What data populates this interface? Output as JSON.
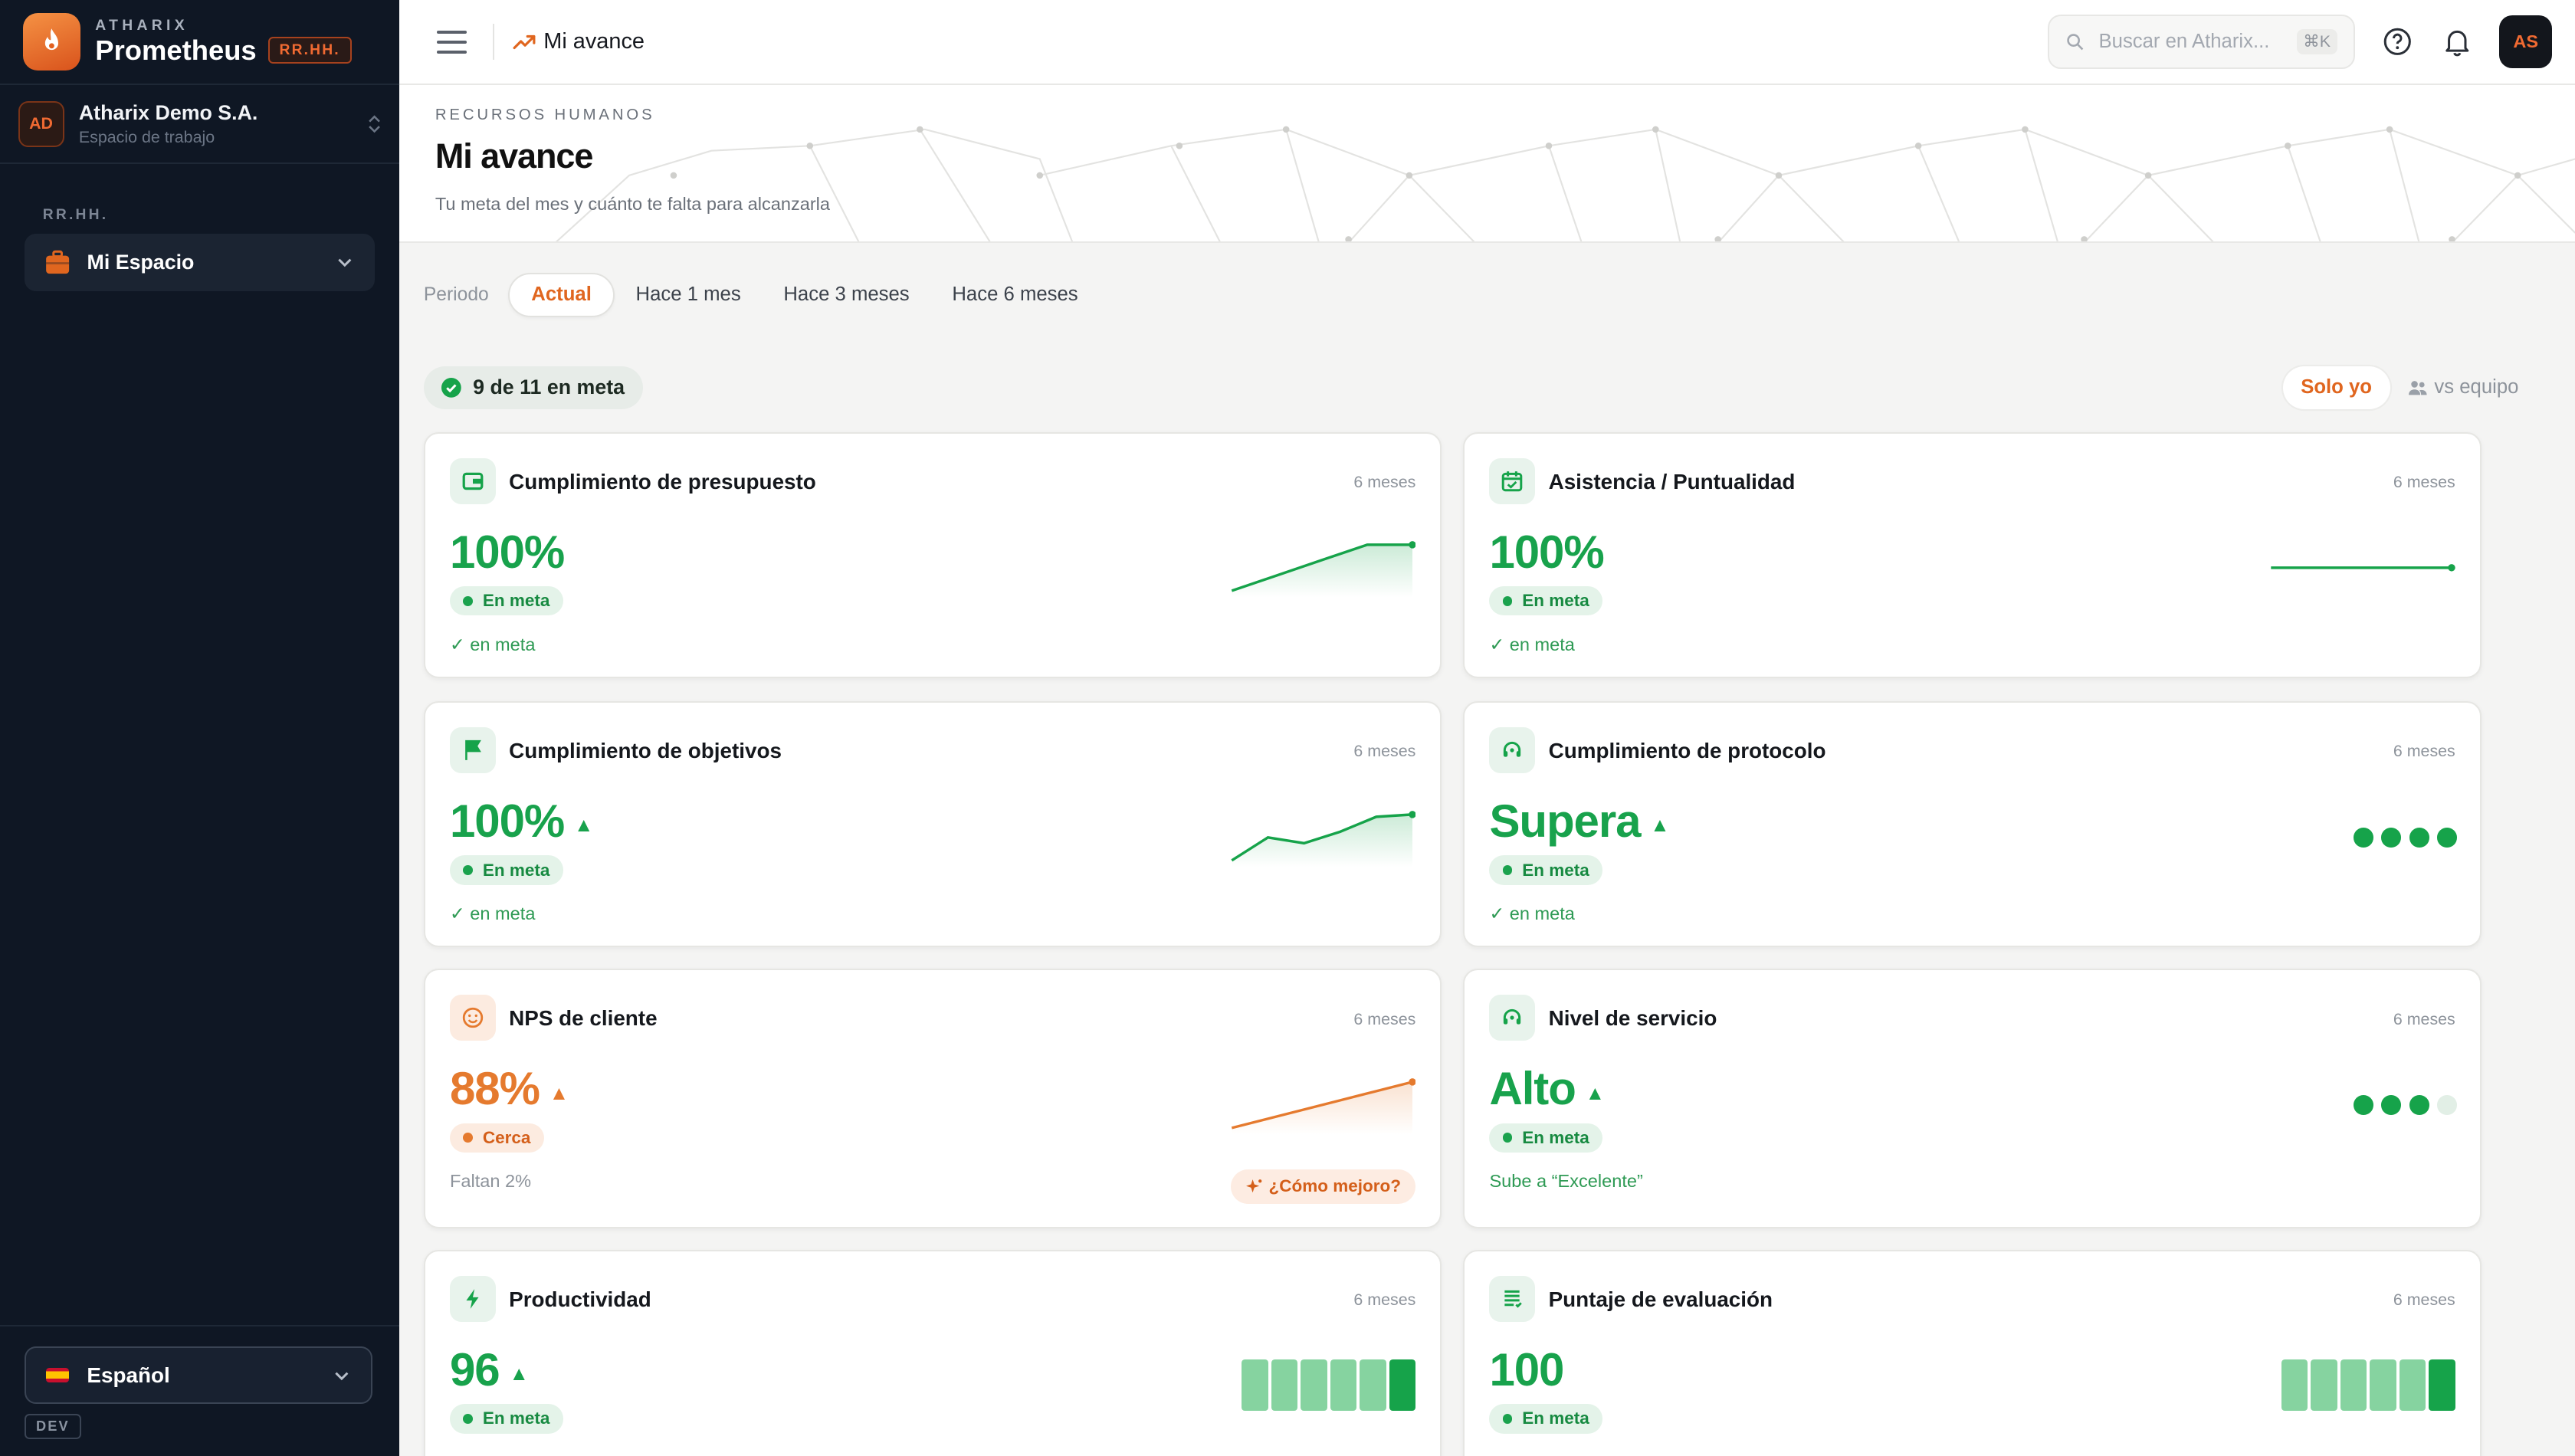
{
  "brand": {
    "company": "ATHARIX",
    "app": "Prometheus",
    "tag": "RR.HH."
  },
  "workspace": {
    "initials": "AD",
    "name": "Atharix Demo S.A.",
    "sub": "Espacio de trabajo"
  },
  "sidebar": {
    "section": "RR.HH.",
    "items": [
      {
        "label": "Mi Espacio",
        "icon": "briefcase-icon"
      }
    ]
  },
  "language": {
    "label": "Español",
    "env": "DEV"
  },
  "topbar": {
    "breadcrumb": "Mi avance",
    "search_placeholder": "Buscar en Atharix...",
    "search_shortcut": "⌘K",
    "user_initials": "AS"
  },
  "header": {
    "eyebrow": "RECURSOS HUMANOS",
    "title": "Mi avance",
    "subtitle": "Tu meta del mes y cuánto te falta para alcanzarla"
  },
  "period": {
    "label": "Periodo",
    "tabs": [
      "Actual",
      "Hace 1 mes",
      "Hace 3 meses",
      "Hace 6 meses"
    ],
    "active": "Actual"
  },
  "summary": {
    "text": "9 de 11 en meta"
  },
  "view_toggle": {
    "options": [
      "Solo yo",
      "vs equipo"
    ],
    "active": "Solo yo"
  },
  "colors": {
    "accent": "#e0661f",
    "success": "#18a24c",
    "warning": "#e57a2e",
    "sidebar_bg": "#0f1724"
  },
  "cards": [
    {
      "title": "Cumplimiento de presupuesto",
      "icon": "wallet-icon",
      "period": "6 meses",
      "value": "100%",
      "trend": "",
      "badge": "En meta",
      "status": "ok",
      "foot": "✓ en meta",
      "viz": "line",
      "series": [
        70,
        80,
        90,
        100,
        100
      ]
    },
    {
      "title": "Asistencia / Puntualidad",
      "icon": "calendar-check-icon",
      "period": "6 meses",
      "value": "100%",
      "trend": "",
      "badge": "En meta",
      "status": "ok",
      "foot": "✓ en meta",
      "viz": "line",
      "series": [
        100,
        100,
        100,
        100,
        100
      ]
    },
    {
      "title": "Cumplimiento de objetivos",
      "icon": "flag-icon",
      "period": "6 meses",
      "value": "100%",
      "trend": "▲",
      "badge": "En meta",
      "status": "ok",
      "foot": "✓ en meta",
      "viz": "line",
      "series": [
        60,
        80,
        75,
        85,
        98,
        100
      ]
    },
    {
      "title": "Cumplimiento de protocolo",
      "icon": "headset-icon",
      "period": "6 meses",
      "value": "Supera",
      "trend": "▲",
      "badge": "En meta",
      "status": "ok",
      "foot": "✓ en meta",
      "viz": "dots",
      "level": 4,
      "level_max": 4
    },
    {
      "title": "NPS de cliente",
      "icon": "smile-icon",
      "period": "6 meses",
      "value": "88%",
      "trend": "▲",
      "badge": "Cerca",
      "status": "near",
      "foot": "Faltan 2%",
      "viz": "line",
      "series": [
        78,
        80,
        82,
        84,
        86,
        88
      ],
      "action": "¿Cómo mejoro?"
    },
    {
      "title": "Nivel de servicio",
      "icon": "headset-icon",
      "period": "6 meses",
      "value": "Alto",
      "trend": "▲",
      "badge": "En meta",
      "status": "ok",
      "foot": "Sube a “Excelente”",
      "viz": "dots",
      "level": 3,
      "level_max": 4
    },
    {
      "title": "Productividad",
      "icon": "bolt-icon",
      "period": "6 meses",
      "value": "96",
      "trend": "▲",
      "badge": "En meta",
      "status": "ok",
      "foot": "",
      "viz": "bars"
    },
    {
      "title": "Puntaje de evaluación",
      "icon": "list-icon",
      "period": "6 meses",
      "value": "100",
      "trend": "",
      "badge": "En meta",
      "status": "ok",
      "foot": "",
      "viz": "bars"
    }
  ]
}
